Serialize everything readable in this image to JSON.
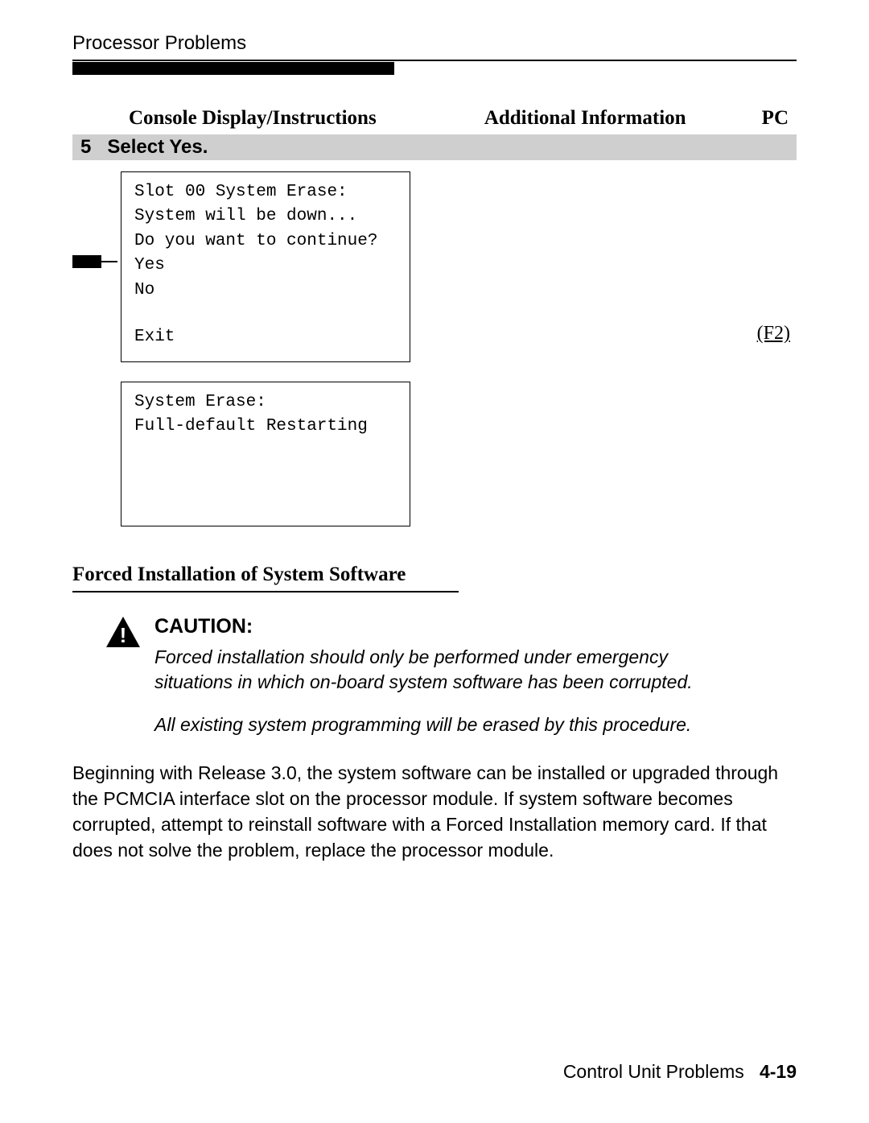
{
  "header": {
    "section": "Processor Problems"
  },
  "columns": {
    "console": "Console Display/Instructions",
    "additional": "Additional Information",
    "pc": "PC"
  },
  "step": {
    "number": "5",
    "title": "Select Yes.",
    "console1": {
      "lines": [
        "Slot 00 System Erase:",
        "System will be down...",
        "Do you want to continue?",
        "Yes",
        "No"
      ],
      "exit": "Exit"
    },
    "console2": {
      "lines": [
        "System Erase:",
        "Full-default Restarting"
      ]
    },
    "pcKey": "(F2)"
  },
  "section": {
    "title": "Forced Installation of System Software"
  },
  "caution": {
    "heading": "CAUTION:",
    "para1": "Forced installation should only be performed under emergency situations in which on-board system software has been corrupted.",
    "para2": "All existing system programming will be erased by this procedure."
  },
  "body": {
    "para": "Beginning with Release 3.0, the system software can be installed or upgraded through the PCMCIA interface slot on the processor module. If system software becomes corrupted, attempt to reinstall software with a Forced Installation memory card. If that does not solve the problem, replace the processor module."
  },
  "footer": {
    "chapter": "Control Unit Problems",
    "page": "4-19"
  }
}
